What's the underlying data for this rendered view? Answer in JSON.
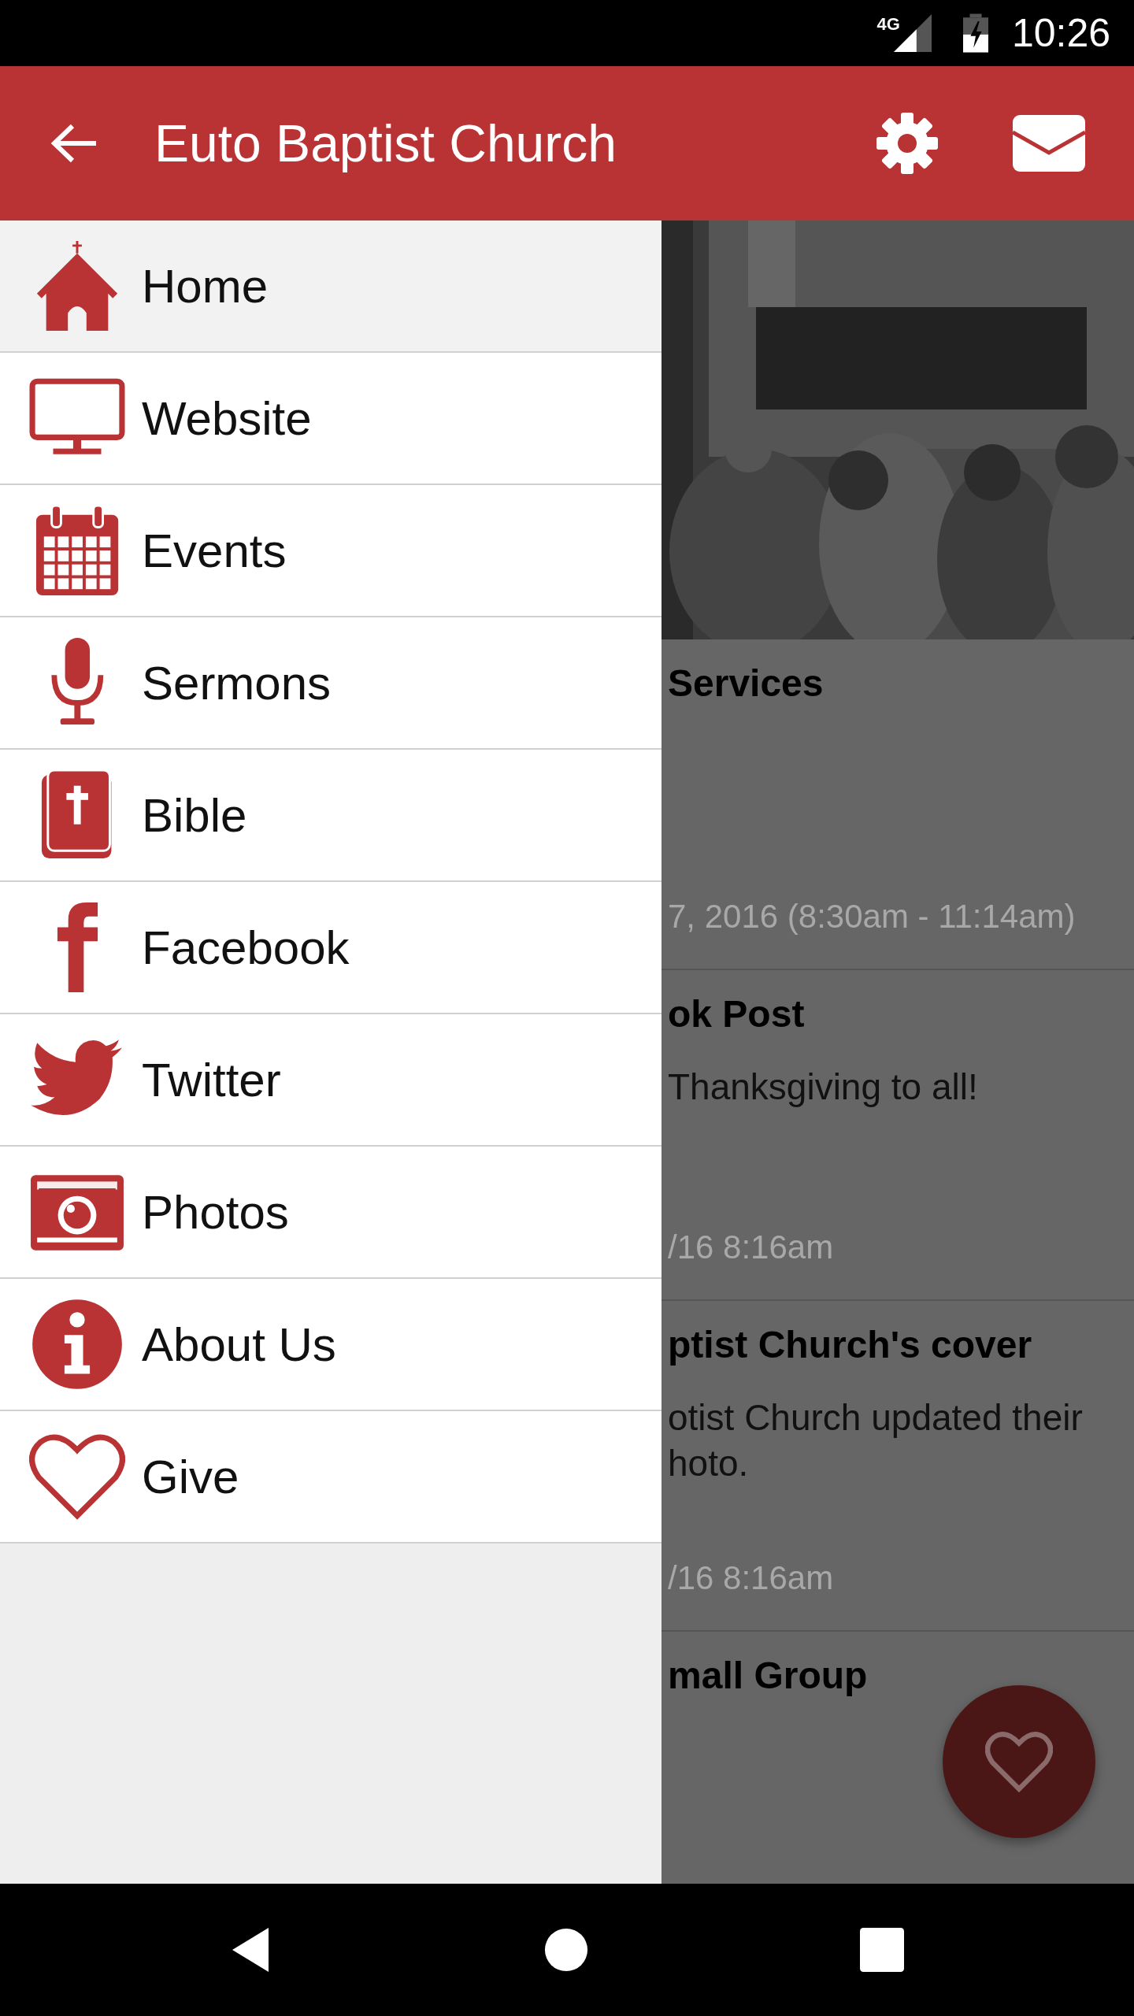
{
  "status_bar": {
    "network": "4G",
    "time": "10:26"
  },
  "app_bar": {
    "title": "Euto Baptist Church"
  },
  "drawer": {
    "items": [
      {
        "label": "Home",
        "kind": "house",
        "selected": true
      },
      {
        "label": "Website",
        "kind": "monitor",
        "selected": false
      },
      {
        "label": "Events",
        "kind": "calendar",
        "selected": false
      },
      {
        "label": "Sermons",
        "kind": "microphone",
        "selected": false
      },
      {
        "label": "Bible",
        "kind": "bible",
        "selected": false
      },
      {
        "label": "Facebook",
        "kind": "facebook",
        "selected": false
      },
      {
        "label": "Twitter",
        "kind": "twitter",
        "selected": false
      },
      {
        "label": "Photos",
        "kind": "camera",
        "selected": false
      },
      {
        "label": "About Us",
        "kind": "info",
        "selected": false
      },
      {
        "label": "Give",
        "kind": "heart",
        "selected": false
      }
    ]
  },
  "feed": {
    "cards": [
      {
        "title": "Services",
        "date": "7, 2016 (8:30am - 11:14am)"
      },
      {
        "title": "ok Post",
        "body": [
          "Thanksgiving to all!"
        ],
        "date": "/16 8:16am"
      },
      {
        "title": "ptist Church's cover",
        "body": [
          "otist Church updated their",
          "hoto."
        ],
        "date": "/16 8:16am"
      },
      {
        "title": "mall Group"
      }
    ]
  }
}
